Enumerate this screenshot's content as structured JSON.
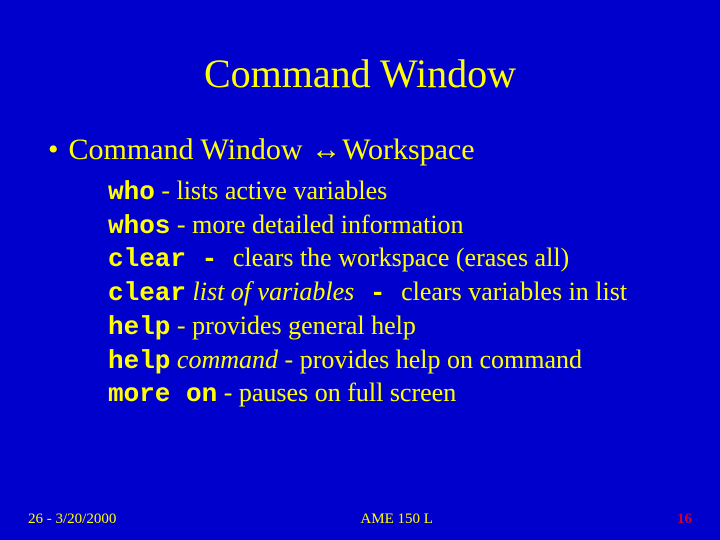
{
  "title": "Command Window",
  "bullet": {
    "text_left": "Command Window ",
    "arrow": "↔",
    "text_right": "Workspace"
  },
  "rows": [
    {
      "cmd": "who",
      "arg": "",
      "sep": "  - ",
      "desc": "lists active variables"
    },
    {
      "cmd": "whos",
      "arg": "",
      "sep": "  - ",
      "desc": "more detailed information"
    },
    {
      "cmd": "clear",
      "arg": "",
      "sep": " - ",
      "desc": "clears the workspace (erases all)"
    },
    {
      "cmd": "clear",
      "arg": " list of variables",
      "sep": " - ",
      "desc": "clears variables in list"
    },
    {
      "cmd": "help",
      "arg": "",
      "sep": " - ",
      "desc": "provides general help"
    },
    {
      "cmd": "help",
      "arg": " command",
      "sep": " - ",
      "desc": "provides help on command"
    },
    {
      "cmd": "more on",
      "arg": "",
      "sep": "  - ",
      "desc": "pauses on full screen"
    }
  ],
  "footer": {
    "left": "26 - 3/20/2000",
    "center": "AME 150 L",
    "page": "16"
  }
}
